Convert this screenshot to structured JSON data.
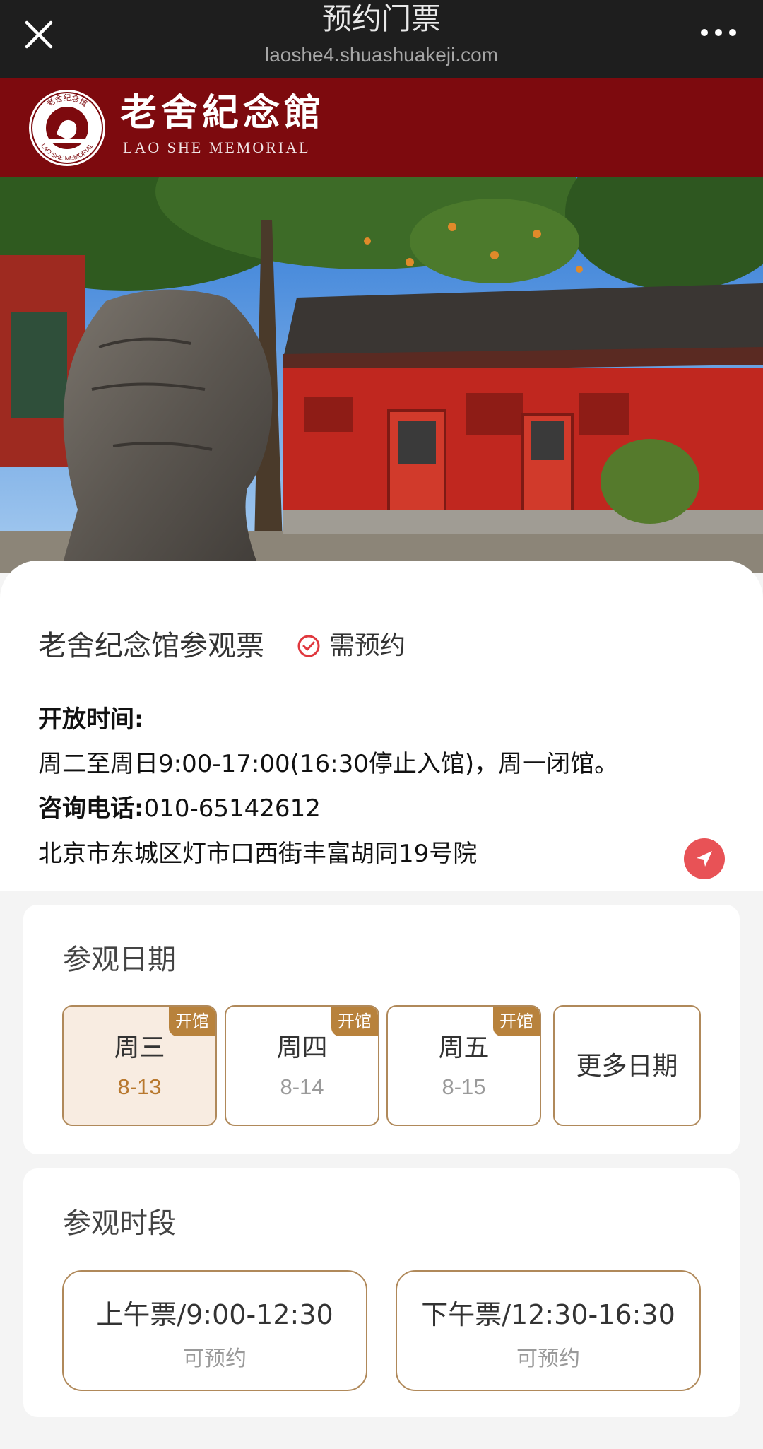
{
  "navbar": {
    "title": "预约门票",
    "url": "laoshe4.shuashuakeji.com"
  },
  "brand": {
    "name_cn": "老舍紀念館",
    "name_en": "LAO SHE MEMORIAL",
    "logo_text_top": "老舍纪念馆",
    "logo_text_bottom": "LAO SHE MEMORIAL",
    "color": "#7d0a0e"
  },
  "hero": {
    "icon": "memorial-courtyard-photo"
  },
  "ticket": {
    "name": "老舍纪念馆参观票",
    "reserve_label": "需预约",
    "hours_label": "开放时间:",
    "hours_text": "周二至周日9:00-17:00(16:30停止入馆)，周一闭馆。",
    "phone_label": "咨询电话:",
    "phone_value": "010-65142612",
    "address": "北京市东城区灯市口西街丰富胡同19号院",
    "accent": "#e85256"
  },
  "visit_date": {
    "title": "参观日期",
    "options": [
      {
        "day": "周三",
        "date": "8-13",
        "badge": "开馆",
        "selected": true
      },
      {
        "day": "周四",
        "date": "8-14",
        "badge": "开馆",
        "selected": false
      },
      {
        "day": "周五",
        "date": "8-15",
        "badge": "开馆",
        "selected": false
      }
    ],
    "more_label": "更多日期",
    "accent": "#b8823c"
  },
  "visit_time": {
    "title": "参观时段",
    "slots": [
      {
        "label": "上午票/9:00-12:30",
        "status": "可预约"
      },
      {
        "label": "下午票/12:30-16:30",
        "status": "可预约"
      }
    ]
  }
}
